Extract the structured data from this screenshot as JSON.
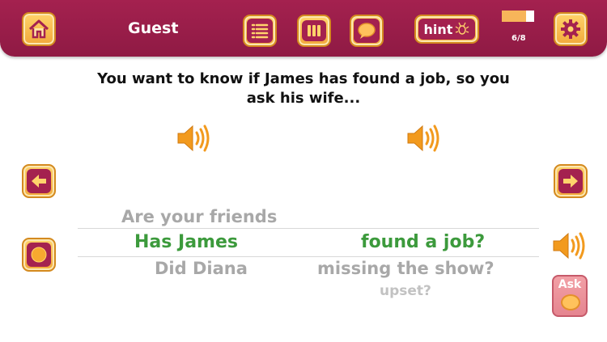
{
  "header": {
    "user_label": "Guest",
    "hint_label": "hint",
    "progress_text": "6/8",
    "progress_fraction": 0.75
  },
  "prompt": {
    "line1": "You want to know if James has found a job, so you",
    "line2": "ask his wife..."
  },
  "picker": {
    "left_column": {
      "above": "Are your friends",
      "selected": "Has James",
      "below": "Did Diana"
    },
    "right_column": {
      "selected": "found a job?",
      "below": "missing the show?",
      "below2": "upset?"
    }
  },
  "ask_label": "Ask",
  "colors": {
    "bar": "#a4214f",
    "button_gold": "#f2a93b",
    "selected_text": "#3c9a3c",
    "speaker": "#f29a1e"
  },
  "icons": [
    "home-icon",
    "list-icon",
    "columns-icon",
    "speech-bubble-icon",
    "bug-icon",
    "gear-icon",
    "speaker-icon",
    "arrow-left-icon",
    "arrow-right-icon",
    "record-icon"
  ]
}
